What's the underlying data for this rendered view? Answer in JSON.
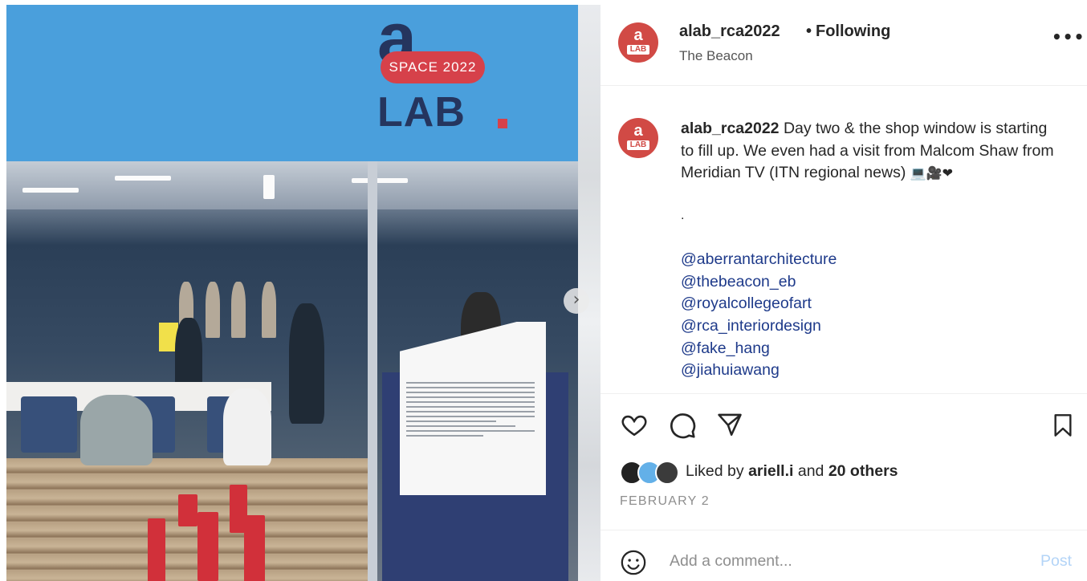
{
  "post": {
    "sign": {
      "logo_letter": "a",
      "pill": "SPACE 2022",
      "lab": "LAB"
    },
    "header": {
      "username": "alab_rca2022",
      "separator": "•",
      "follow_status": "Following",
      "location": "The Beacon"
    },
    "caption": {
      "username": "alab_rca2022",
      "text": "Day two & the shop window is starting to fill up. We even had a visit from Malcom Shaw from Meridian TV (ITN regional news)",
      "emojis": "💻🎥❤",
      "bullet": ".",
      "mentions": [
        "@aberrantarchitecture",
        "@thebeacon_eb",
        "@royalcollegeofart",
        "@rca_interiordesign",
        "@fake_hang",
        "@jiahuiawang"
      ]
    },
    "likes": {
      "prefix": "Liked by",
      "user": "ariell.i",
      "connector": "and",
      "others": "20 others"
    },
    "date": "FEBRUARY 2",
    "comment_placeholder": "Add a comment...",
    "post_label": "Post",
    "avatar": {
      "top": "a",
      "bottom": "LAB"
    }
  },
  "icons": [
    "heart-icon",
    "comment-icon",
    "share-icon",
    "bookmark-icon",
    "emoji-icon",
    "more-icon",
    "next-arrow-icon"
  ]
}
